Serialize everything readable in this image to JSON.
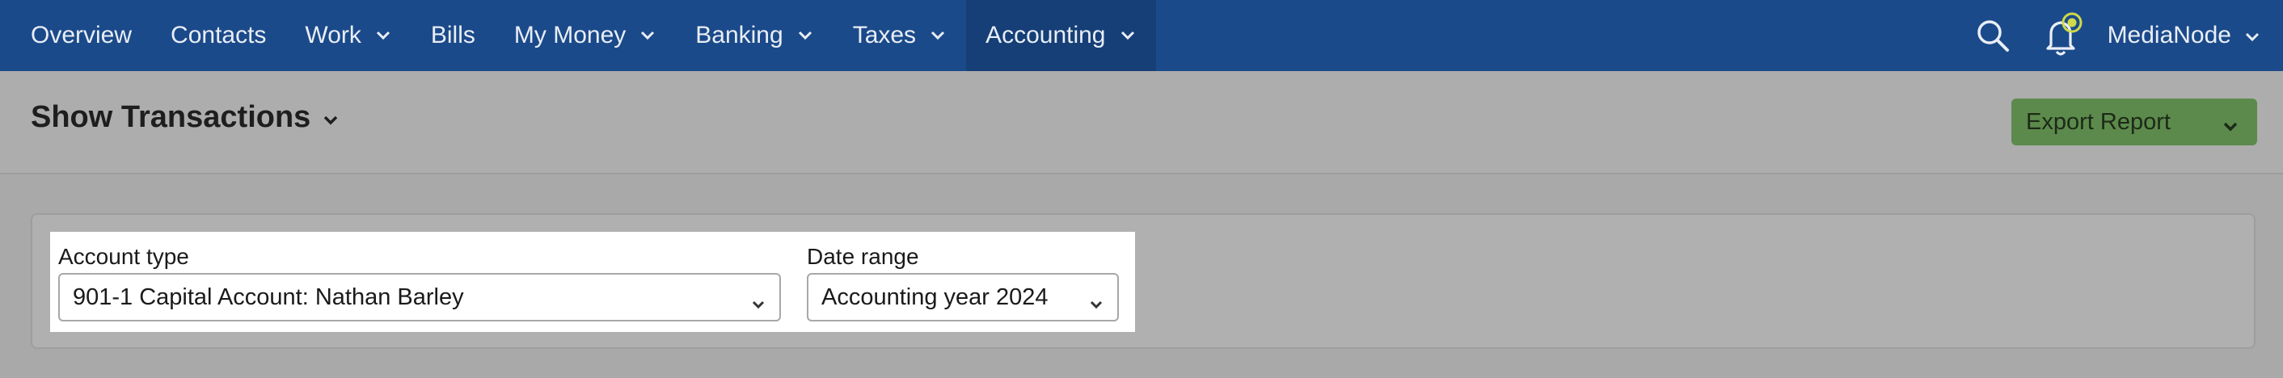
{
  "nav": {
    "items": [
      {
        "label": "Overview",
        "dropdown": false
      },
      {
        "label": "Contacts",
        "dropdown": false
      },
      {
        "label": "Work",
        "dropdown": true
      },
      {
        "label": "Bills",
        "dropdown": false
      },
      {
        "label": "My Money",
        "dropdown": true
      },
      {
        "label": "Banking",
        "dropdown": true
      },
      {
        "label": "Taxes",
        "dropdown": true
      },
      {
        "label": "Accounting",
        "dropdown": true,
        "active": true
      }
    ],
    "user_label": "MediaNode",
    "icons": [
      "search-icon",
      "notification-bell-icon"
    ]
  },
  "header": {
    "title": "Show Transactions",
    "export_label": "Export Report"
  },
  "filters": {
    "account_type_label": "Account type",
    "account_type_value": "901-1 Capital Account: Nathan Barley",
    "date_range_label": "Date range",
    "date_range_value": "Accounting year 2024"
  },
  "colors": {
    "nav_bg": "#1b4a8a",
    "nav_active_bg": "#163f77",
    "export_button": "#5c8a4c",
    "overlay": "#a9a9a9"
  }
}
